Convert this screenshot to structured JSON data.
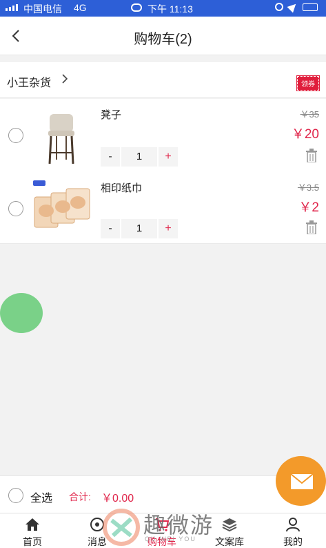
{
  "status_bar": {
    "carrier": "中国电信",
    "network": "4G",
    "time": "下午 11:13"
  },
  "header": {
    "back_icon": "chevron-left-icon",
    "title": "购物车(2)"
  },
  "shop": {
    "name": "小王杂货",
    "coupon_label": "领券"
  },
  "items": [
    {
      "name": "凳子",
      "original_price": "￥35",
      "price": "￥20",
      "quantity": "1",
      "minus_label": "-",
      "plus_label": "+",
      "image": "bar-stool-image"
    },
    {
      "name": "相印纸巾",
      "original_price": "￥3.5",
      "price": "￥2",
      "quantity": "1",
      "minus_label": "-",
      "plus_label": "+",
      "image": "tissue-pack-image"
    }
  ],
  "footer": {
    "select_all_label": "全选",
    "total_label": "合计:",
    "total_value": "￥0.00"
  },
  "tabbar": {
    "tabs": [
      {
        "label": "首页",
        "icon": "home-icon"
      },
      {
        "label": "消息",
        "icon": "message-icon"
      },
      {
        "label": "购物车",
        "icon": "cart-icon",
        "active": true
      },
      {
        "label": "文案库",
        "icon": "stack-icon"
      },
      {
        "label": "我的",
        "icon": "user-icon"
      }
    ]
  },
  "watermark": {
    "text": "趣微游",
    "sub": "QU WEI YOU"
  },
  "colors": {
    "accent": "#e0264b",
    "status_bar": "#2d5fd7",
    "mail_button": "#f39a2a",
    "floating_circle": "#7ad188"
  }
}
